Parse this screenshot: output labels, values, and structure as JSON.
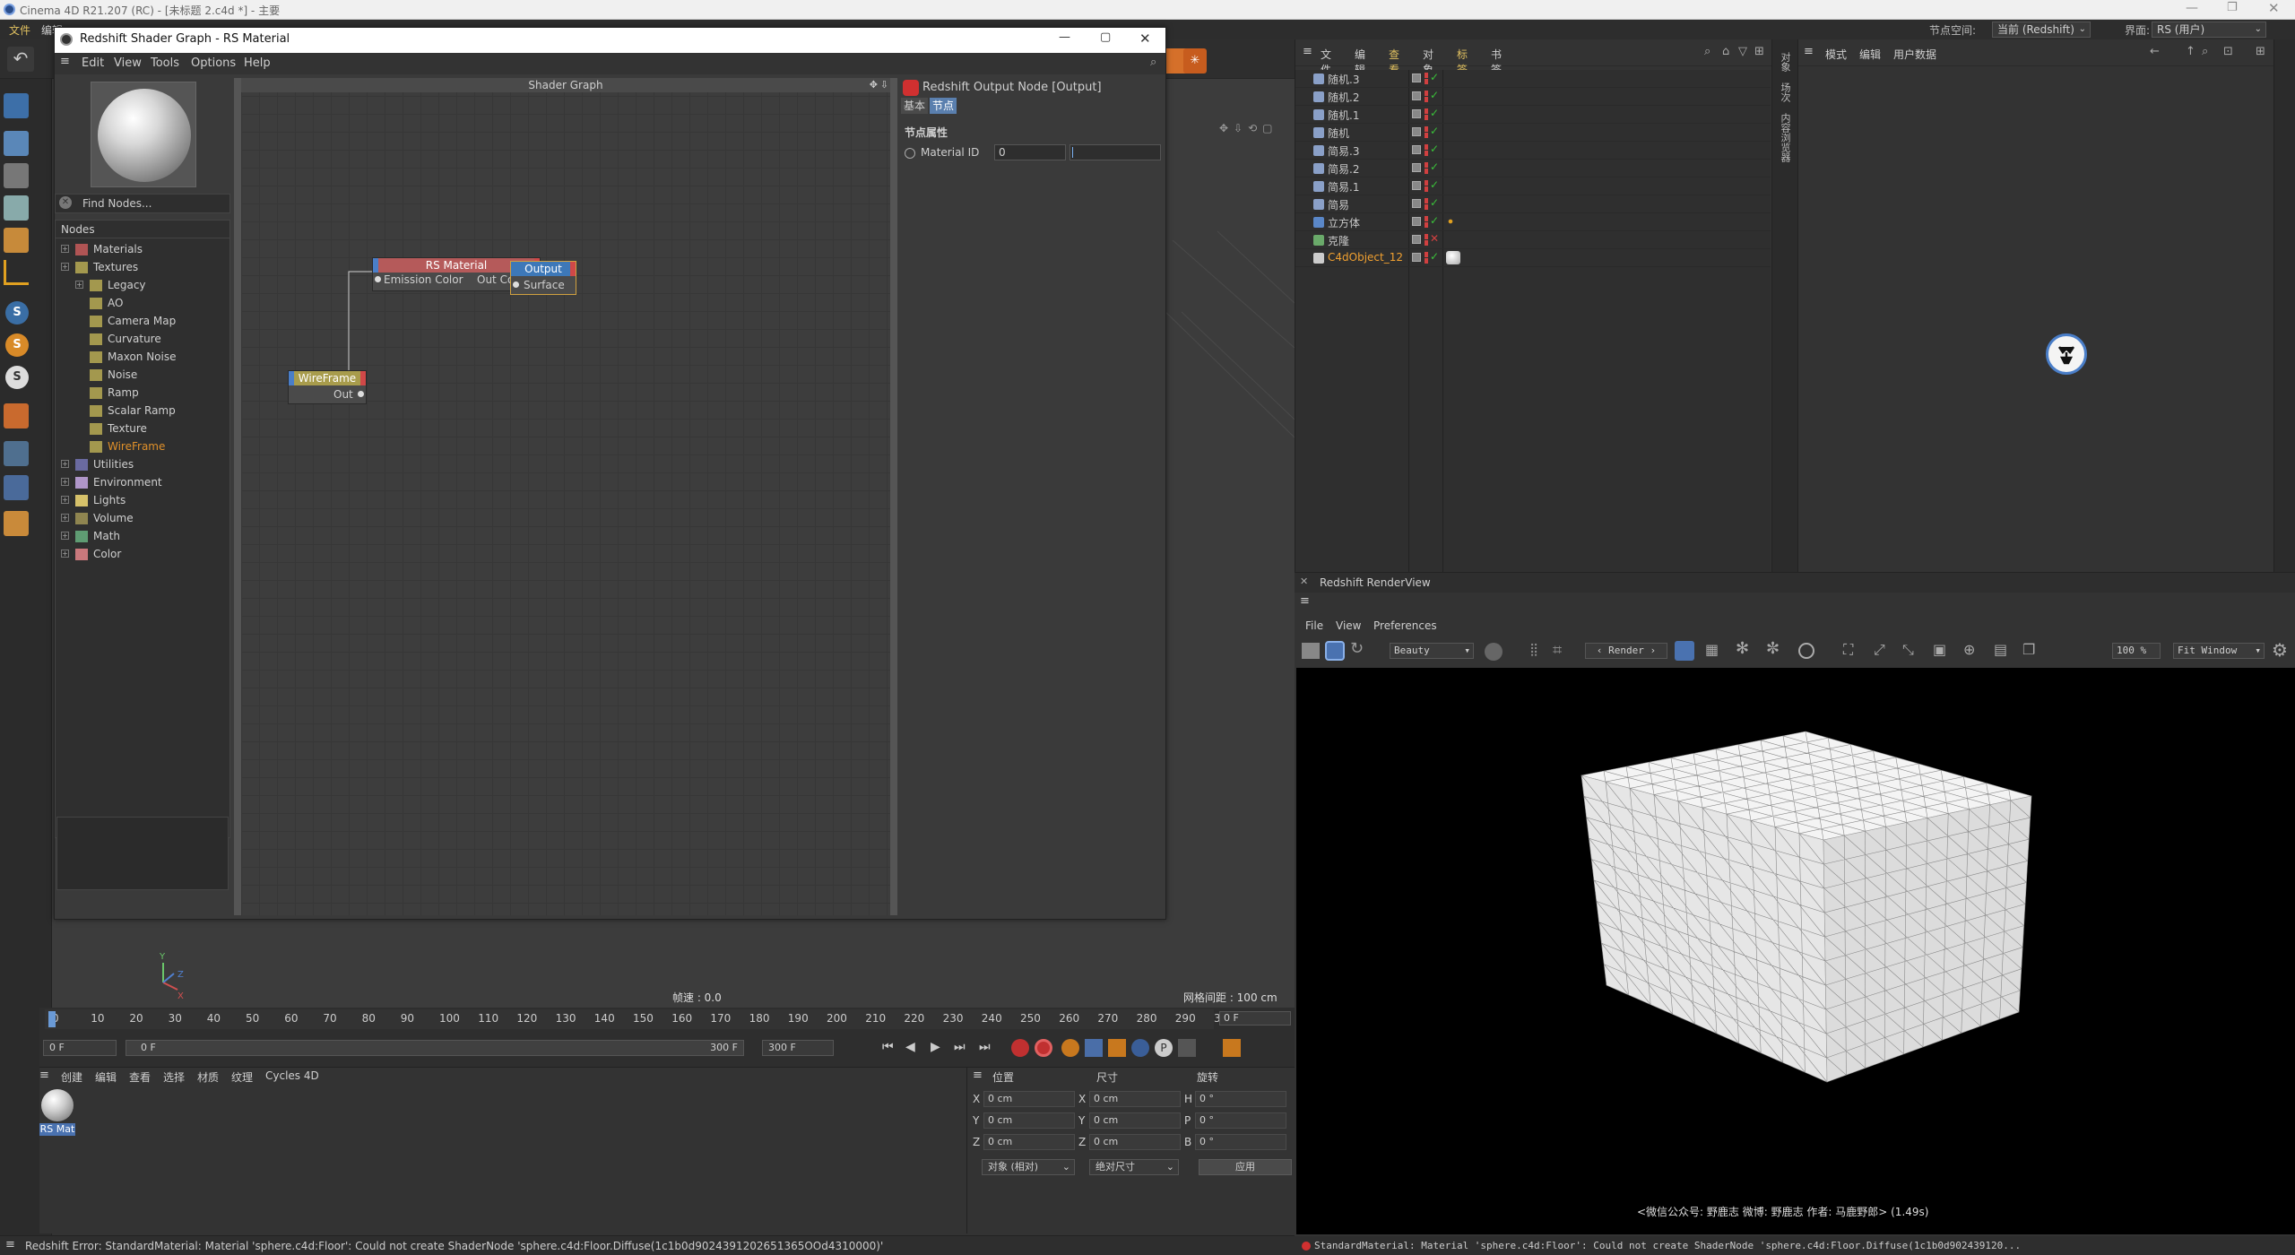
{
  "app": {
    "title": "Cinema 4D R21.207 (RC) - [未标题 2.c4d *] - 主要",
    "menu": [
      "文件",
      "编辑"
    ],
    "node_space_label": "节点空间:",
    "node_space_value": "当前 (Redshift)",
    "layout_label": "界面:",
    "layout_value": "RS (用户)"
  },
  "shader_window": {
    "title": "Redshift Shader Graph - RS Material",
    "menu": [
      "Edit",
      "View",
      "Tools",
      "Options",
      "Help"
    ],
    "find_nodes": "Find Nodes...",
    "nodes_header": "Nodes",
    "tree": [
      {
        "label": "Materials",
        "color": "#b05454"
      },
      {
        "label": "Textures",
        "color": "#a3984e"
      },
      {
        "label": "Legacy",
        "color": "#a3984e"
      },
      {
        "label": "AO",
        "color": "#a3984e"
      },
      {
        "label": "Camera Map",
        "color": "#a3984e"
      },
      {
        "label": "Curvature",
        "color": "#a3984e"
      },
      {
        "label": "Maxon Noise",
        "color": "#a3984e"
      },
      {
        "label": "Noise",
        "color": "#a3984e"
      },
      {
        "label": "Ramp",
        "color": "#a3984e"
      },
      {
        "label": "Scalar Ramp",
        "color": "#a3984e"
      },
      {
        "label": "Texture",
        "color": "#a3984e"
      },
      {
        "label": "WireFrame",
        "color": "#a3984e"
      },
      {
        "label": "Utilities",
        "color": "#6a6aa0"
      },
      {
        "label": "Environment",
        "color": "#b096c9"
      },
      {
        "label": "Lights",
        "color": "#d6c16a"
      },
      {
        "label": "Volume",
        "color": "#8f8550"
      },
      {
        "label": "Math",
        "color": "#5f9c73"
      },
      {
        "label": "Color",
        "color": "#c9787c"
      }
    ],
    "graph_title": "Shader Graph",
    "node_rs_material": {
      "title": "RS Material",
      "in": "Emission Color",
      "out": "Out Color"
    },
    "node_output": {
      "title": "Output",
      "in": "Surface"
    },
    "node_wireframe": {
      "title": "WireFrame",
      "out": "Out"
    },
    "attr_title": "Redshift Output Node [Output]",
    "attr_tabs": [
      "基本",
      "节点"
    ],
    "attr_section": "节点属性",
    "attr_field_label": "Material ID",
    "attr_field_value": "0"
  },
  "viewport": {
    "fps": "帧速 : 0.0",
    "grid": "网格间距 : 100 cm"
  },
  "timeline": {
    "ticks": [
      "0",
      "10",
      "20",
      "30",
      "40",
      "50",
      "60",
      "70",
      "80",
      "90",
      "100",
      "110",
      "120",
      "130",
      "140",
      "150",
      "160",
      "170",
      "180",
      "190",
      "200",
      "210",
      "220",
      "230",
      "240",
      "250",
      "260",
      "270",
      "280",
      "290",
      "30"
    ],
    "end_frame_field": "0 F",
    "start_field": "0 F",
    "current_field": "0 F",
    "range_end": "300 F",
    "max_field": "300 F"
  },
  "material_manager": {
    "menu": [
      "创建",
      "编辑",
      "查看",
      "选择",
      "材质",
      "纹理",
      "Cycles 4D"
    ],
    "material_label": "RS Mat"
  },
  "coords": {
    "headers": [
      "位置",
      "尺寸",
      "旋转"
    ],
    "rows": [
      {
        "a": "X",
        "av": "0 cm",
        "b": "X",
        "bv": "0 cm",
        "c": "H",
        "cv": "0 °"
      },
      {
        "a": "Y",
        "av": "0 cm",
        "b": "Y",
        "bv": "0 cm",
        "c": "P",
        "cv": "0 °"
      },
      {
        "a": "Z",
        "av": "0 cm",
        "b": "Z",
        "bv": "0 cm",
        "c": "B",
        "cv": "0 °"
      }
    ],
    "mode1": "对象 (相对)",
    "mode2": "绝对尺寸",
    "apply": "应用"
  },
  "status": {
    "left": "Redshift Error: StandardMaterial: Material 'sphere.c4d:Floor': Could not create ShaderNode 'sphere.c4d:Floor.Diffuse(1c1b0d9024391202651365OOd4310000)'",
    "right": "StandardMaterial: Material 'sphere.c4d:Floor': Could not create ShaderNode 'sphere.c4d:Floor.Diffuse(1c1b0d902439120..."
  },
  "object_manager": {
    "menu": [
      "文件",
      "编辑",
      "查看",
      "对象",
      "标签",
      "书签"
    ],
    "objects": [
      {
        "name": "随机.3",
        "color": "#c8c8c8"
      },
      {
        "name": "随机.2",
        "color": "#c8c8c8"
      },
      {
        "name": "随机.1",
        "color": "#c8c8c8"
      },
      {
        "name": "随机",
        "color": "#c8c8c8"
      },
      {
        "name": "简易.3",
        "color": "#c8c8c8"
      },
      {
        "name": "简易.2",
        "color": "#c8c8c8"
      },
      {
        "name": "简易.1",
        "color": "#c8c8c8"
      },
      {
        "name": "简易",
        "color": "#c8c8c8"
      },
      {
        "name": "立方体",
        "color": "#c8c8c8"
      },
      {
        "name": "克隆",
        "color": "#c8c8c8"
      },
      {
        "name": "C4dObject_12",
        "color": "#f0a030"
      }
    ]
  },
  "attribute_manager": {
    "menu": [
      "模式",
      "编辑",
      "用户数据"
    ],
    "side_tabs": [
      "对象",
      "场次",
      "内容浏览器"
    ]
  },
  "renderview": {
    "title": "Redshift RenderView",
    "menu": [
      "File",
      "View",
      "Preferences"
    ],
    "aov": "Beauty",
    "render_btn": "Render",
    "zoom": "100 %",
    "fit": "Fit Window",
    "watermark": "<微信公众号: 野鹿志  微博: 野鹿志  作者: 马鹿野郎> (1.49s)"
  }
}
